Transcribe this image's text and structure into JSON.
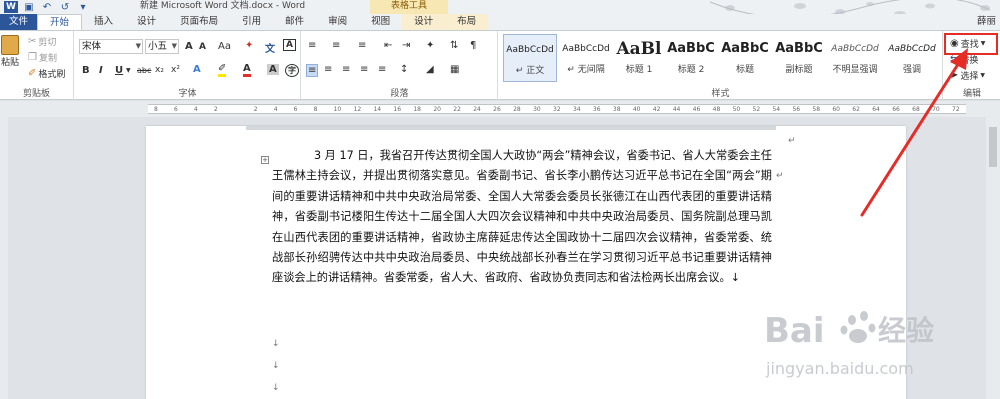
{
  "window": {
    "title": "新建 Microsoft Word 文档.docx - Word",
    "context_group": "表格工具",
    "user": "薛丽"
  },
  "tabs": [
    {
      "label": "文件"
    },
    {
      "label": "开始"
    },
    {
      "label": "插入"
    },
    {
      "label": "设计"
    },
    {
      "label": "页面布局"
    },
    {
      "label": "引用"
    },
    {
      "label": "邮件"
    },
    {
      "label": "审阅"
    },
    {
      "label": "视图"
    },
    {
      "label": "设计"
    },
    {
      "label": "布局"
    }
  ],
  "clipboard": {
    "paste": "粘贴",
    "cut": "剪切",
    "copy": "复制",
    "format_painter": "格式刷",
    "label": "剪贴板"
  },
  "font": {
    "family": "宋体",
    "size": "小五",
    "label": "字体",
    "bold": "B",
    "italic": "I",
    "underline": "U",
    "strike": "abc",
    "sub": "x₂",
    "sup": "x²",
    "grow": "A",
    "shrink": "A",
    "case": "Aa",
    "color_a": "A"
  },
  "paragraph": {
    "label": "段落"
  },
  "styles": {
    "label": "样式",
    "items": [
      {
        "sample": "AaBbCcDd",
        "label": "↵ 正文"
      },
      {
        "sample": "AaBbCcDd",
        "label": "↵ 无间隔"
      },
      {
        "sample": "AaBl",
        "label": "标题 1"
      },
      {
        "sample": "AaBbC",
        "label": "标题 2"
      },
      {
        "sample": "AaBbC",
        "label": "标题"
      },
      {
        "sample": "AaBbC",
        "label": "副标题"
      },
      {
        "sample": "AaBbCcDd",
        "label": "不明显强调"
      },
      {
        "sample": "AaBbCcDd",
        "label": "强调"
      }
    ]
  },
  "editing": {
    "find": "查找",
    "replace": "替换",
    "select": "选择",
    "label": "编辑"
  },
  "ruler": {
    "numbers": [
      "8",
      "6",
      "4",
      "2",
      "",
      "2",
      "4",
      "6",
      "8",
      "10",
      "12",
      "14",
      "16",
      "18",
      "20",
      "22",
      "24",
      "26",
      "28",
      "30",
      "32",
      "34",
      "36",
      "38",
      "40",
      "42",
      "44",
      "46",
      "48",
      "50",
      "52",
      "54",
      "56",
      "58",
      "60",
      "62",
      "64",
      "66",
      "68",
      "70",
      "72"
    ]
  },
  "document": {
    "paragraph": "3 月 17 日，我省召开传达贯彻全国人大政协“两会”精神会议，省委书记、省人大常委会主任王儒林主持会议，并提出贯彻落实意见。省委副书记、省长李小鹏传达习近平总书记在全国“两会”期间的重要讲话精神和中共中央政治局常委、全国人大常委会委员长张德江在山西代表团的重要讲话精神，省委副书记楼阳生传达十二届全国人大四次会议精神和中共中央政治局委员、国务院副总理马凯在山西代表团的重要讲话精神，省政协主席薛延忠传达全国政协十二届四次会议精神，省委常委、统战部长孙绍骋传达中共中央政治局委员、中央统战部长孙春兰在学习贯彻习近平总书记重要讲话精神座谈会上的讲话精神。省委常委，省人大、省政府、省政协负责同志和省法检两长出席会议。↓"
  },
  "colors": {
    "accent": "#2b579a",
    "highlight": "#e52d27",
    "context": "#f6e7b3"
  },
  "watermark": {
    "brand": "Bai 经验",
    "url": "jingyan.baidu.com"
  }
}
